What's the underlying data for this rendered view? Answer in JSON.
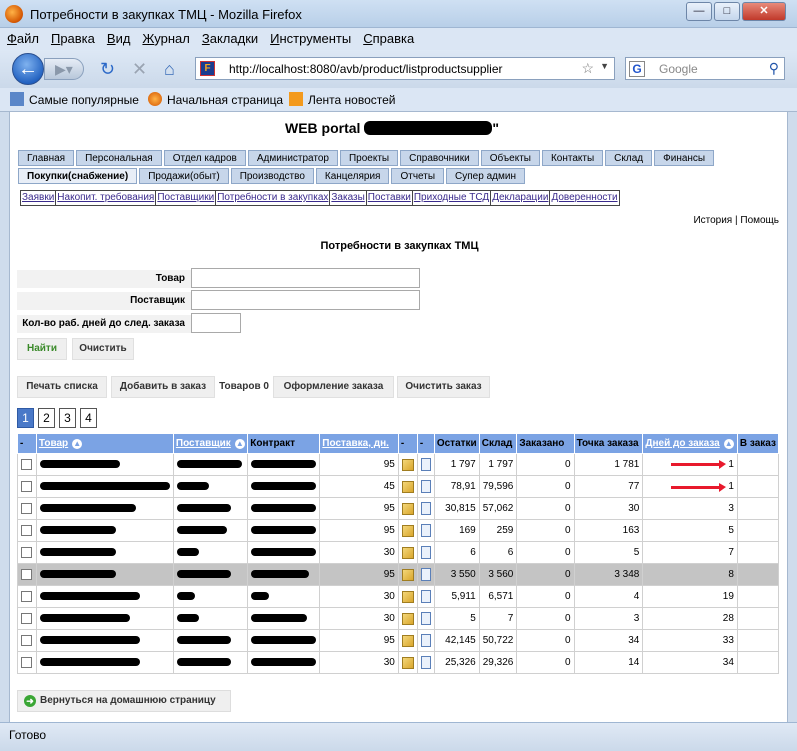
{
  "window": {
    "title": "Потребности в закупках ТМЦ - Mozilla Firefox",
    "min": "—",
    "max": "□",
    "close": "✕"
  },
  "menu": [
    "Файл",
    "Правка",
    "Вид",
    "Журнал",
    "Закладки",
    "Инструменты",
    "Справка"
  ],
  "nav": {
    "url": "http://localhost:8080/avb/product/listproductsupplier",
    "search_placeholder": "Google"
  },
  "bookmarks": [
    "Самые популярные",
    "Начальная страница",
    "Лента новостей"
  ],
  "portal": {
    "title_prefix": "WEB portal ",
    "title_suffix": "\""
  },
  "tabs_row1": [
    "Главная",
    "Персональная",
    "Отдел кадров",
    "Администратор",
    "Проекты",
    "Справочники",
    "Объекты",
    "Контакты",
    "Склад",
    "Финансы"
  ],
  "tabs_row2": [
    "Покупки(снабжение)",
    "Продажи(обыт)",
    "Производство",
    "Канцелярия",
    "Отчеты",
    "Супер админ"
  ],
  "subtabs": [
    "Заявки",
    "Накопит. требования",
    "Поставщики",
    "Потребности в закупках",
    "Заказы",
    "Поставки",
    "Приходные ТСД",
    "Декларации",
    "Доверенности"
  ],
  "toplinks": {
    "history": "История",
    "sep": " | ",
    "help": "Помощь"
  },
  "page_title": "Потребности в закупках ТМЦ",
  "filters": {
    "product": "Товар",
    "supplier": "Поставщик",
    "days": "Кол-во раб. дней до след. заказа"
  },
  "buttons": {
    "find": "Найти",
    "clear": "Очистить",
    "print": "Печать списка",
    "add_to_order": "Добавить в заказ",
    "items_label": "Товаров 0",
    "make_order": "Оформление заказа",
    "clear_order": "Очистить заказ",
    "home": "Вернуться на домашнюю страницу"
  },
  "pages": [
    "1",
    "2",
    "3",
    "4"
  ],
  "table": {
    "headers": [
      "-",
      "Товар",
      "Поставщик",
      "Контракт",
      "Поставка, дн.",
      "-",
      "-",
      "Остатки",
      "Склад",
      "Заказано",
      "Точка заказа",
      "Дней до заказа",
      "В заказ"
    ],
    "rows": [
      {
        "delivery": "95",
        "stock": "1 797",
        "warehouse": "1 797",
        "ordered": "0",
        "point": "1 781",
        "days": "1",
        "sel": false
      },
      {
        "delivery": "45",
        "stock": "78,91",
        "warehouse": "79,596",
        "ordered": "0",
        "point": "77",
        "days": "1",
        "sel": false
      },
      {
        "delivery": "95",
        "stock": "30,815",
        "warehouse": "57,062",
        "ordered": "0",
        "point": "30",
        "days": "3",
        "sel": false
      },
      {
        "delivery": "95",
        "stock": "169",
        "warehouse": "259",
        "ordered": "0",
        "point": "163",
        "days": "5",
        "sel": false
      },
      {
        "delivery": "30",
        "stock": "6",
        "warehouse": "6",
        "ordered": "0",
        "point": "5",
        "days": "7",
        "sel": false
      },
      {
        "delivery": "95",
        "stock": "3 550",
        "warehouse": "3 560",
        "ordered": "0",
        "point": "3 348",
        "days": "8",
        "sel": true
      },
      {
        "delivery": "30",
        "stock": "5,911",
        "warehouse": "6,571",
        "ordered": "0",
        "point": "4",
        "days": "19",
        "sel": false
      },
      {
        "delivery": "30",
        "stock": "5",
        "warehouse": "7",
        "ordered": "0",
        "point": "3",
        "days": "28",
        "sel": false
      },
      {
        "delivery": "95",
        "stock": "42,145",
        "warehouse": "50,722",
        "ordered": "0",
        "point": "34",
        "days": "33",
        "sel": false
      },
      {
        "delivery": "30",
        "stock": "25,326",
        "warehouse": "29,326",
        "ordered": "0",
        "point": "14",
        "days": "34",
        "sel": false
      }
    ]
  },
  "status": "Готово"
}
